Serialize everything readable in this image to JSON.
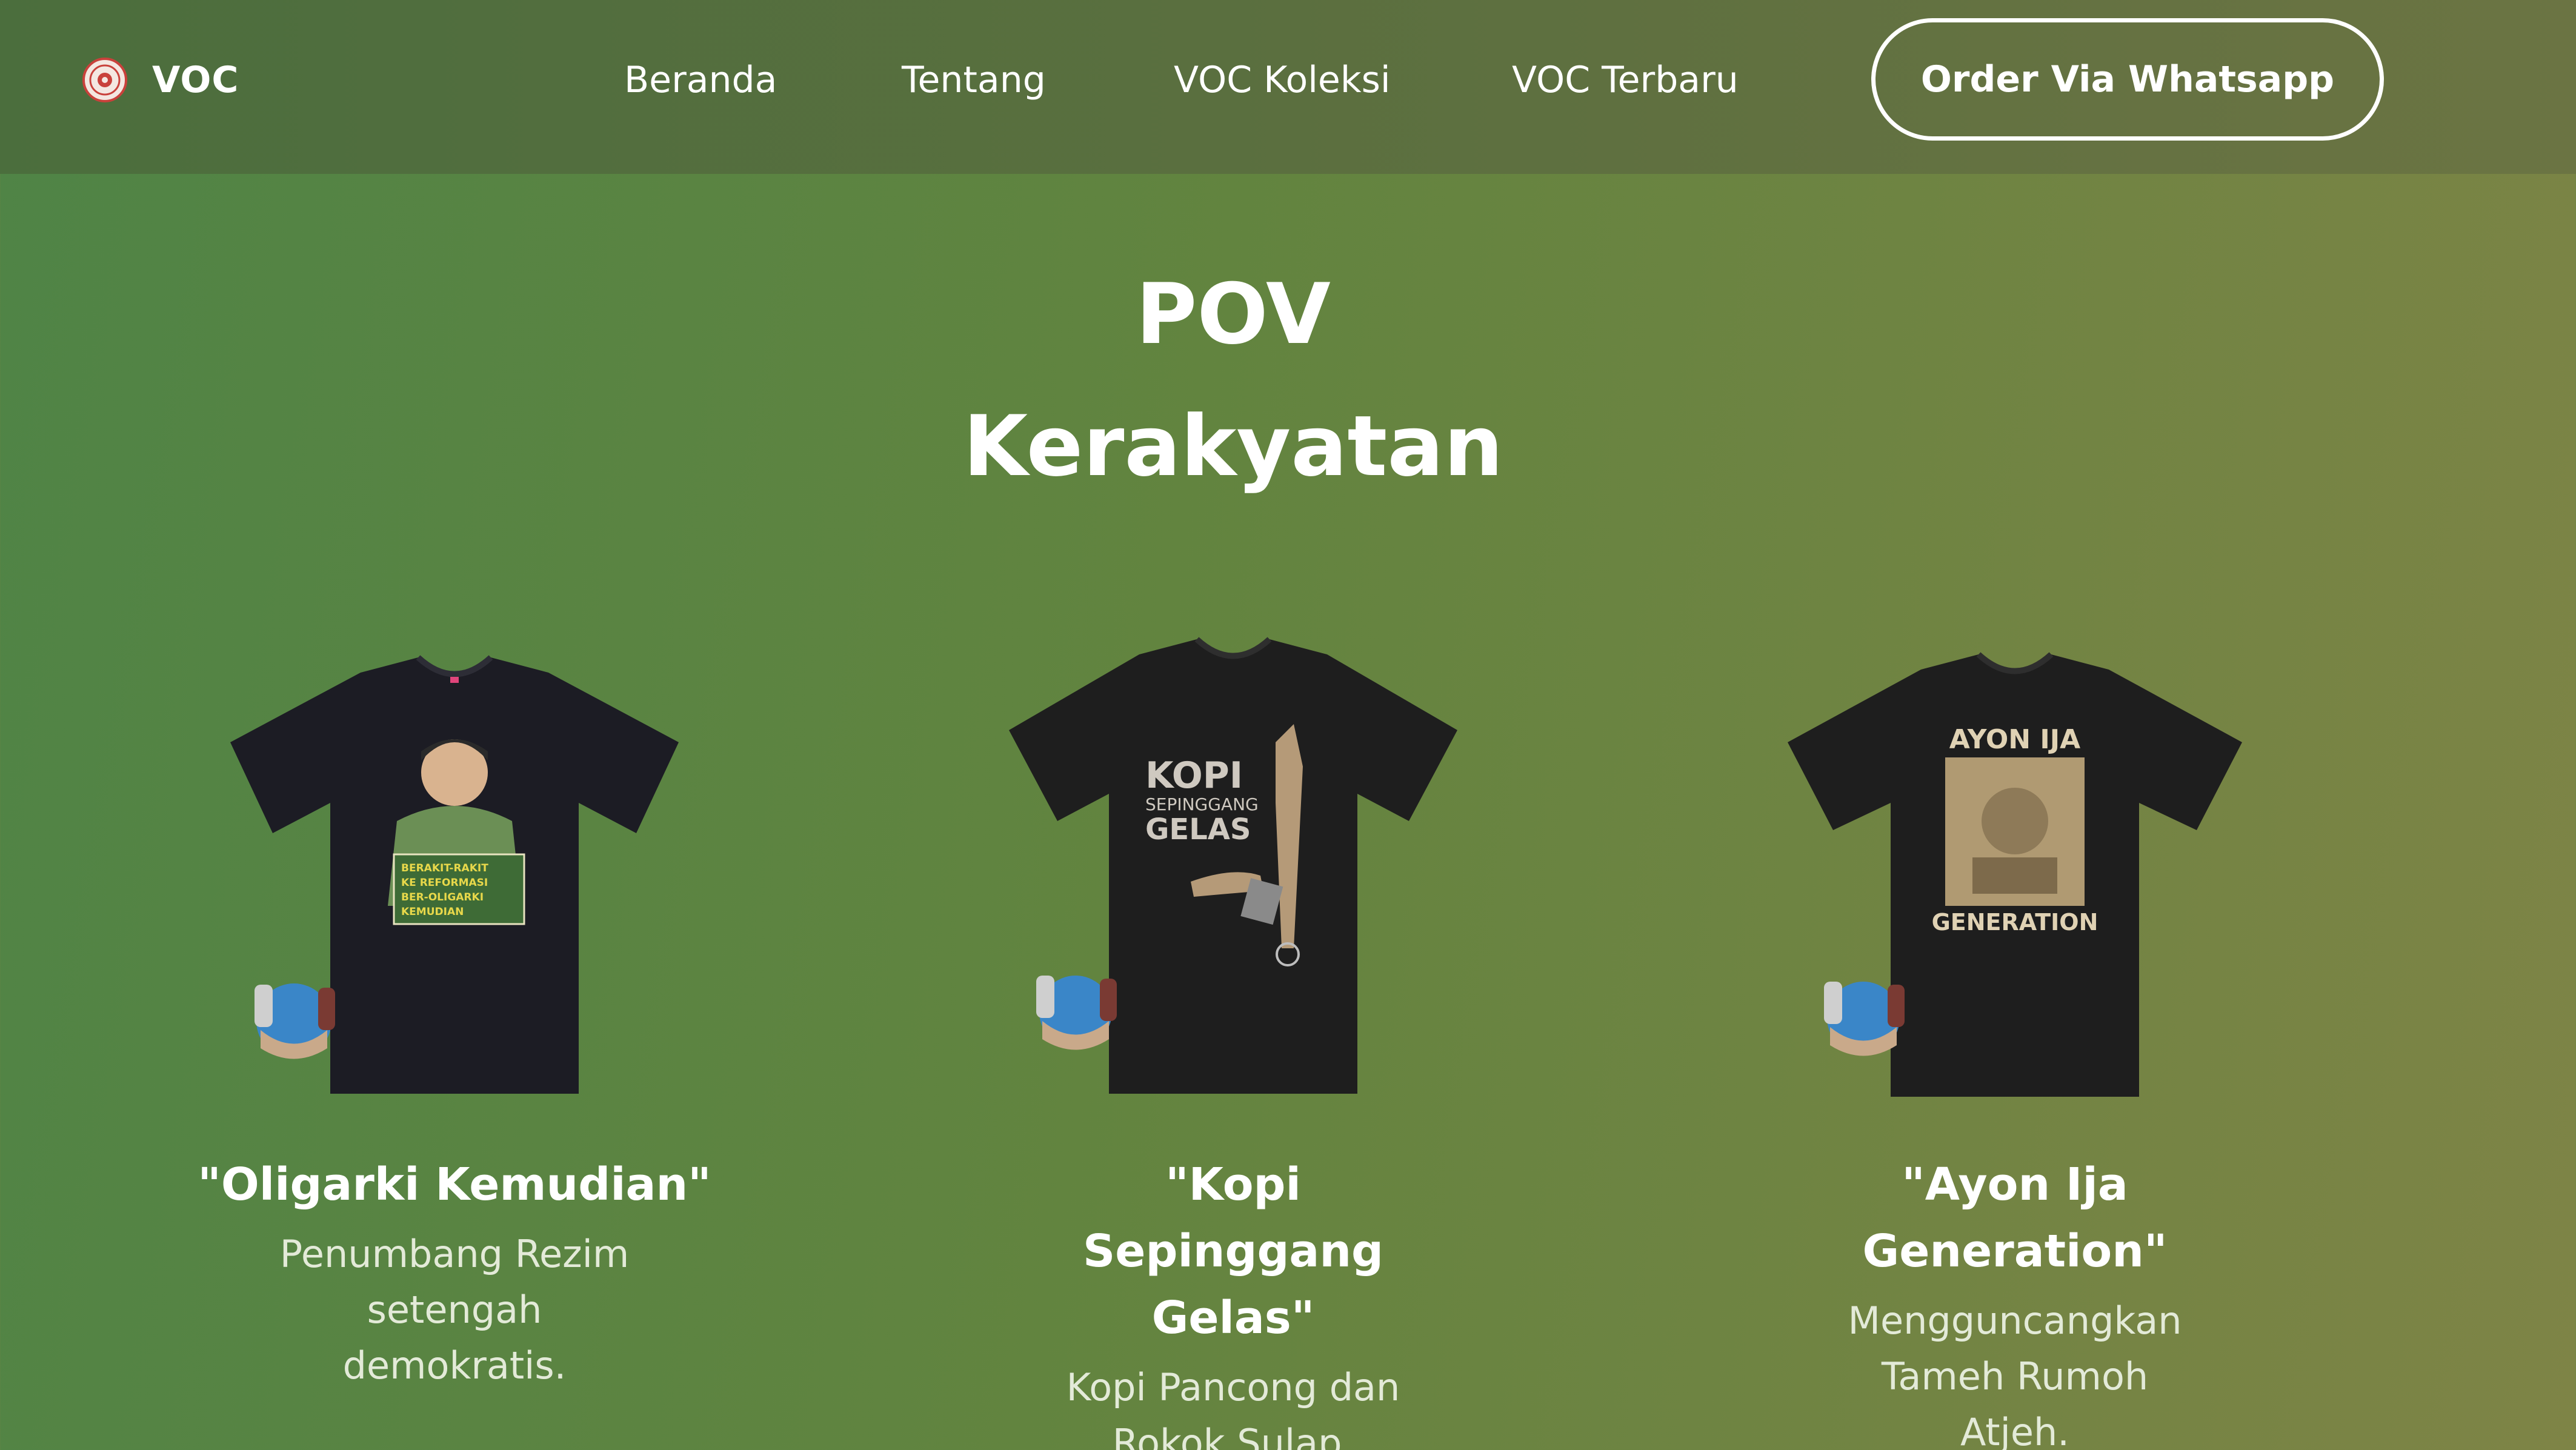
{
  "brand": {
    "name": "VOC",
    "logo_icon": "seal-logo-icon"
  },
  "nav": {
    "links": [
      "Beranda",
      "Tentang",
      "VOC Koleksi",
      "VOC Terbaru"
    ],
    "cta_label": "Order Via Whatsapp"
  },
  "hero": {
    "title_line1": "POV",
    "title_line2": "Kerakyatan"
  },
  "products": [
    {
      "title": "\"Oligarki Kemudian\"",
      "description": "Penumbang Rezim setengah demokratis.",
      "shirt_print": [
        "BERAKIT-RAKIT",
        "KE REFORMASI",
        "BER-OLIGARKI",
        "KEMUDIAN"
      ]
    },
    {
      "title": "\"Kopi Sepinggang Gelas\"",
      "description": "Kopi Pancong dan Rokok Sulap.",
      "shirt_print": [
        "KOPI",
        "SEPINGGANG",
        "GELAS"
      ]
    },
    {
      "title": "\"Ayon Ija Generation\"",
      "description": "Mengguncangkan Tameh Rumoh Atjeh.",
      "shirt_print": [
        "AYON IJA",
        "GENERATION"
      ]
    }
  ],
  "colors": {
    "background_left": "#4f8446",
    "background_right": "#7e8446",
    "navbar": "#5b6f3f",
    "shirt": "#1c1c1c",
    "text": "#ffffff",
    "muted_text": "#e3ead8"
  }
}
